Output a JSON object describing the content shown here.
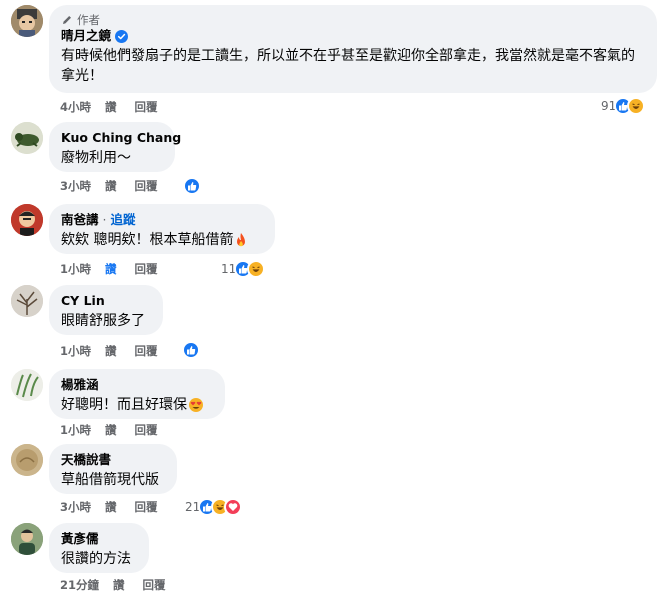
{
  "comments": [
    {
      "badge": "作者",
      "author": "晴月之鏡",
      "verified": true,
      "text": "有時候他們發扇子的是工讀生，所以並不在乎甚至是歡迎你全部拿走，我當然就是毫不客氣的拿光！",
      "time": "4小時",
      "like": "讚",
      "reply": "回覆",
      "reaction_count": "91"
    },
    {
      "author": "Kuo Ching Chang",
      "text": "廢物利用～",
      "time": "3小時",
      "like": "讚",
      "reply": "回覆"
    },
    {
      "author": "南爸講",
      "follow_sep": "·",
      "follow": "追蹤",
      "text": "欸欸 聰明欸！根本草船借箭",
      "time": "1小時",
      "like": "讚",
      "reply": "回覆",
      "reaction_count": "11"
    },
    {
      "author": "CY Lin",
      "text": "眼睛舒服多了",
      "time": "1小時",
      "like": "讚",
      "reply": "回覆"
    },
    {
      "author": "楊雅涵",
      "text": "好聰明！而且好環保",
      "time": "1小時",
      "like": "讚",
      "reply": "回覆"
    },
    {
      "author": "天橋說書",
      "text": "草船借箭現代版",
      "time": "3小時",
      "like": "讚",
      "reply": "回覆",
      "reaction_count": "21"
    },
    {
      "author": "黃彥儒",
      "text": "很讚的方法",
      "time": "21分鐘",
      "like": "讚",
      "reply": "回覆"
    }
  ],
  "colors": {
    "bubble": "#f0f2f5",
    "meta_text": "#65676b",
    "like_blue": "#1877f2",
    "follow_link": "#0064d1",
    "haha_yellow": "#f7b125",
    "love_red": "#f33e58"
  }
}
